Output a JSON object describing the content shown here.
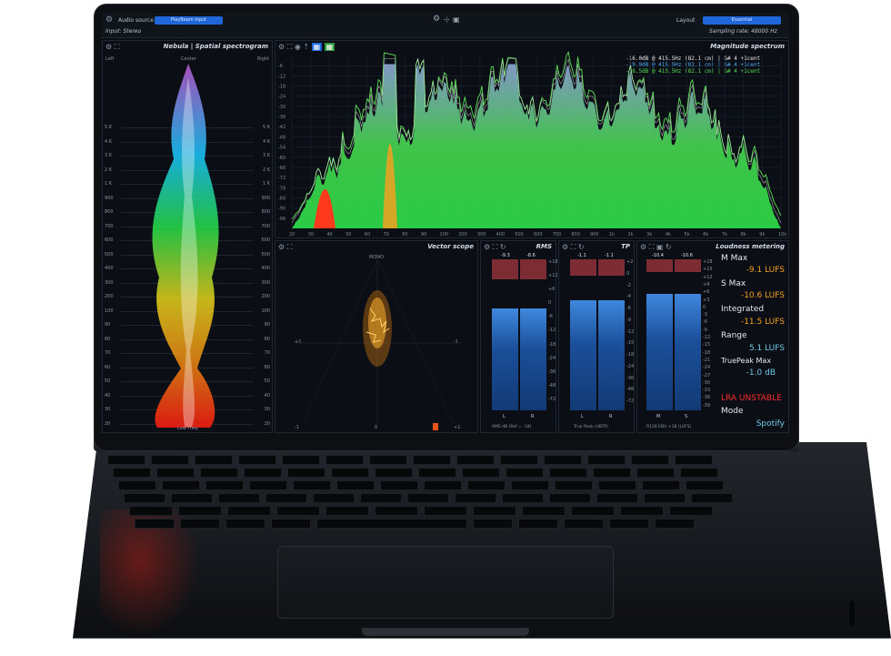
{
  "topbar": {
    "audio_source_label": "Audio source",
    "audio_source_value": "PlayBeam input",
    "input_label": "Input: Stereo",
    "layout_label": "Layout",
    "layout_value": "Essential",
    "sampling_rate": "Sampling rate: 48000 Hz"
  },
  "spectrogram": {
    "title": "Nebula | Spatial spectrogram",
    "left": "Left",
    "center": "Center",
    "right": "Right",
    "bottom": "Low Freq.",
    "scale": [
      "5 K",
      "4 K",
      "3 K",
      "2 K",
      "1 K",
      "900",
      "800",
      "700",
      "600",
      "500",
      "400",
      "300",
      "200",
      "100",
      "90",
      "80",
      "70",
      "60",
      "50",
      "40",
      "30",
      "20"
    ]
  },
  "magnitude": {
    "title": "Magnitude spectrum",
    "peaks": [
      {
        "db": "-16.0dB @",
        "freq": "415.5Hz (82.1 cm)",
        "note": "| G# 4",
        "cent": "+1cent",
        "color": "#e8e8e8"
      },
      {
        "db": "-19.9dB @",
        "freq": "415.5Hz (82.1 cm)",
        "note": "| G# 4",
        "cent": "+1cent",
        "color": "#4fb3ff"
      },
      {
        "db": "-18.5dB @",
        "freq": "415.5Hz (82.1 cm)",
        "note": "| G# 4",
        "cent": "+1cent",
        "color": "#55dd55"
      }
    ],
    "xticks": [
      "20",
      "30",
      "40",
      "50",
      "60",
      "70",
      "80",
      "90",
      "100",
      "200",
      "300",
      "400",
      "500",
      "600",
      "700",
      "800",
      "900",
      "1k",
      "2k",
      "3k",
      "4k",
      "5k",
      "6k",
      "7k",
      "8k",
      "9k",
      "10k"
    ],
    "yticks": [
      "-6",
      "-12",
      "-18",
      "-24",
      "-30",
      "-36",
      "-42",
      "-48",
      "-54",
      "-60",
      "-66",
      "-72",
      "-78",
      "-84",
      "-90",
      "-96"
    ]
  },
  "vectorscope": {
    "title": "Vector scope",
    "mono": "MONO",
    "left_val": "+1",
    "right_val": "-1",
    "bottom_left": "-1",
    "bottom_mid": "0",
    "bottom_right": "+1"
  },
  "rms": {
    "title": "RMS",
    "peak_l": "-9.3",
    "peak_r": "-8.6",
    "footer": "RMS dB (Ref = -18)",
    "chan_l": "L",
    "chan_r": "R",
    "scale": [
      "+18",
      "+12",
      "+6",
      "0",
      "-6",
      "-12",
      "-18",
      "-24",
      "-36",
      "-48",
      "-72"
    ],
    "level_l": 0.78,
    "level_r": 0.78
  },
  "tp": {
    "title": "TP",
    "peak_l": "-1.1",
    "peak_r": "-1.1",
    "footer": "True Peak (dBTP)",
    "chan_l": "L",
    "chan_r": "R",
    "scale": [
      "+2",
      "0",
      "-2",
      "-4",
      "-6",
      "-9",
      "-12",
      "-15",
      "-18",
      "-24",
      "-36",
      "-48",
      "-72"
    ],
    "level_l": 0.82,
    "level_r": 0.82
  },
  "loudness": {
    "title": "Loudness metering",
    "peak_l": "-10.4",
    "peak_r": "-10.6",
    "footer": "R128 EBU +18 (LUFS)",
    "chan_l": "M",
    "chan_r": "S",
    "scale": [
      "+18",
      "+15",
      "+12",
      "+9",
      "+6",
      "+3",
      "0",
      "-3",
      "-6",
      "-9",
      "-12",
      "-15",
      "-18",
      "-21",
      "-24",
      "-27",
      "-30",
      "-33",
      "-36",
      "-39"
    ],
    "level_m": 0.84,
    "level_s": 0.84,
    "m_max_label": "M Max",
    "m_max_value": "-9.1 LUFS",
    "s_max_label": "S Max",
    "s_max_value": "-10.6 LUFS",
    "integrated_label": "Integrated",
    "integrated_value": "-11.5 LUFS",
    "range_label": "Range",
    "range_value": "5.1 LUFS",
    "truepeak_label": "TruePeak Max",
    "truepeak_value": "-1.0 dB",
    "warning": "LRA UNSTABLE",
    "mode_label": "Mode",
    "mode_value": "Spotify"
  },
  "colors": {
    "accent": "#1f67d9",
    "orange": "#f2a122",
    "warn": "#ff2a2a",
    "cyan": "#6fc8e6"
  },
  "icons": {
    "gear": "gear-icon",
    "expand": "expand-icon",
    "refresh": "refresh-icon",
    "camera": "camera-icon"
  }
}
